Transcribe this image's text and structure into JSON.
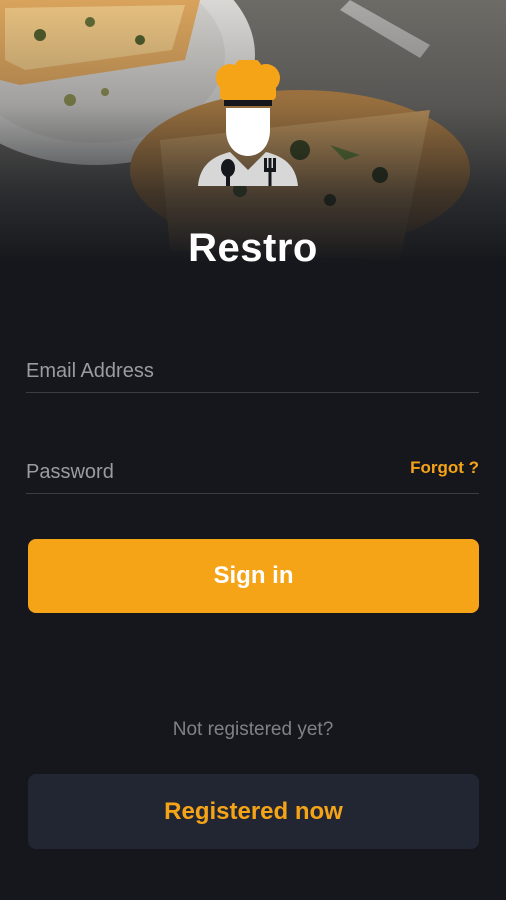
{
  "app": {
    "title": "Restro"
  },
  "login": {
    "email_placeholder": "Email Address",
    "password_placeholder": "Password",
    "forgot_label": "Forgot ?",
    "signin_label": "Sign in",
    "not_registered_text": "Not registered yet?",
    "register_label": "Registered now"
  },
  "colors": {
    "accent": "#f6a417",
    "background": "#15171c",
    "secondary_button": "#222632"
  },
  "icons": {
    "logo": "chef-icon"
  }
}
